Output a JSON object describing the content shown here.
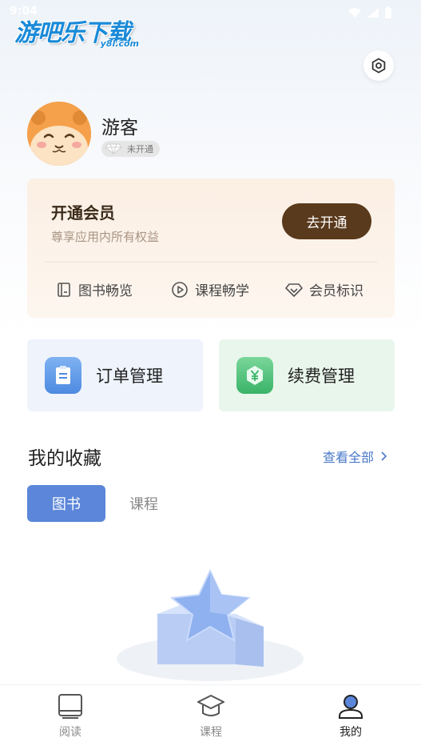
{
  "status_bar": {
    "time": "9:04"
  },
  "watermark": {
    "main": "游吧乐下载",
    "sub": "y8l.com"
  },
  "profile": {
    "username": "游客",
    "vip_status": "未开通"
  },
  "member_card": {
    "title": "开通会员",
    "description": "尊享应用内所有权益",
    "open_button": "去开通",
    "perks": [
      {
        "label": "图书畅览",
        "icon": "book-icon"
      },
      {
        "label": "课程畅学",
        "icon": "play-icon"
      },
      {
        "label": "会员标识",
        "icon": "diamond-icon"
      }
    ]
  },
  "tiles": {
    "order": {
      "label": "订单管理",
      "icon": "order-icon"
    },
    "renew": {
      "label": "续费管理",
      "icon": "yen-icon"
    }
  },
  "favorites": {
    "title": "我的收藏",
    "view_all": "查看全部",
    "tabs": [
      {
        "label": "图书",
        "active": true
      },
      {
        "label": "课程",
        "active": false
      }
    ]
  },
  "bottom_nav": [
    {
      "label": "阅读",
      "icon": "book-nav-icon",
      "active": false
    },
    {
      "label": "课程",
      "icon": "graduation-cap-icon",
      "active": false
    },
    {
      "label": "我的",
      "icon": "user-icon",
      "active": true
    }
  ],
  "colors": {
    "accent": "#5b86d9",
    "link": "#4a78c8",
    "member_button": "#5a3a1c"
  }
}
